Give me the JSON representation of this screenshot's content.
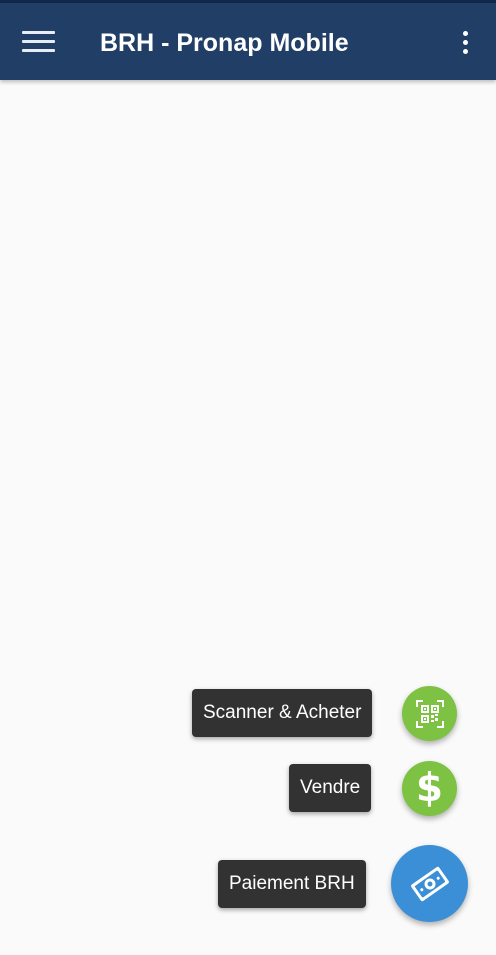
{
  "app_bar": {
    "title": "BRH - Pronap Mobile",
    "menu_icon": "hamburger-menu-icon",
    "overflow_icon": "more-vert-icon",
    "background_color": "#213e67"
  },
  "fab_menu": {
    "actions": [
      {
        "label": "Scanner & Acheter",
        "icon": "qr-code-scan-icon",
        "color": "#7dc242"
      },
      {
        "label": "Vendre",
        "icon": "dollar-icon",
        "glyph": "$",
        "color": "#7dc242"
      },
      {
        "label": "Paiement BRH",
        "icon": "money-payment-icon",
        "color": "#3a8fd6"
      }
    ]
  }
}
